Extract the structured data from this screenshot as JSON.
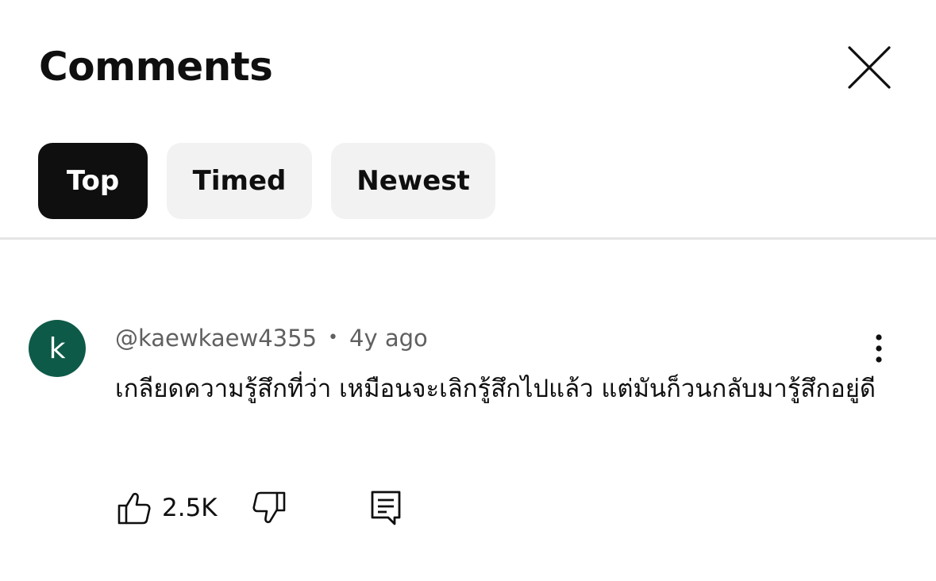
{
  "header": {
    "title": "Comments",
    "close_icon": "close-icon"
  },
  "filters": {
    "chips": [
      {
        "label": "Top",
        "selected": true
      },
      {
        "label": "Timed",
        "selected": false
      },
      {
        "label": "Newest",
        "selected": false
      }
    ]
  },
  "comment": {
    "avatar_letter": "k",
    "avatar_color": "#0e5a48",
    "author": "@kaewkaew4355",
    "separator": "•",
    "time": "4y ago",
    "text": "เกลียดความรู้สึกที่ว่า เหมือนจะเลิกรู้สึกไปแล้ว แต่มันก็วนกลับมารู้สึกอยู่ดี",
    "like_count": "2.5K",
    "icons": {
      "like": "thumbs-up-icon",
      "dislike": "thumbs-down-icon",
      "reply": "reply-comment-icon",
      "more": "more-vertical-icon"
    }
  },
  "colors": {
    "selected_chip_bg": "#0f0f0f",
    "chip_bg": "#f2f2f2",
    "divider": "#e5e5e5",
    "meta_text": "#606060"
  }
}
